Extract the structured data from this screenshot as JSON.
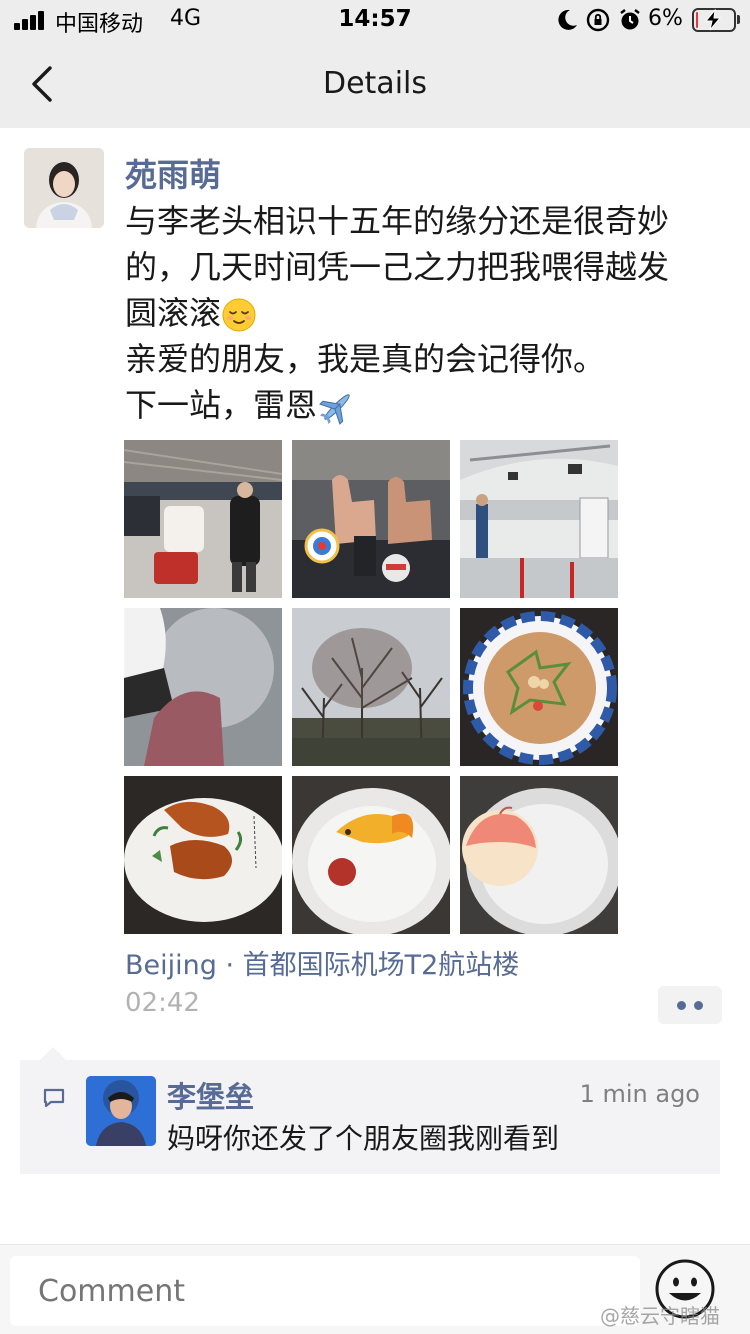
{
  "status_bar": {
    "carrier": "中国移动",
    "network": "4G",
    "time": "14:57",
    "battery": "6%",
    "battery_level": 0.06,
    "icons": [
      "signal-icon",
      "moon-icon",
      "rotation-lock-icon",
      "alarm-icon",
      "battery-icon",
      "charging-bolt-icon"
    ]
  },
  "nav": {
    "title": "Details",
    "back_icon": "chevron-left-icon"
  },
  "post": {
    "author": "苑雨萌",
    "lines": [
      "与李老头相识十五年的缘分还是很奇妙",
      "的，几天时间凭一己之力把我喂得越发",
      "圆滚滚",
      "亲爱的朋友，我是真的会记得你。",
      "下一站，雷恩"
    ],
    "line_emojis": {
      "2": "relieved-face-emoji",
      "4": "airplane-emoji"
    },
    "photos": [
      "airport-check-in-hall-photo",
      "thumbs-up-hands-photo",
      "airport-shooting-range-photo",
      "ground-and-scarf-photo",
      "winter-trees-photo",
      "soup-bowl-photo",
      "duck-dish-plate-photo",
      "goldfish-dessert-photo",
      "peach-bun-photo"
    ],
    "location": "Beijing · 首都国际机场T2航站楼",
    "time": "02:42"
  },
  "comment": {
    "author": "李堡垒",
    "time": "1 min ago",
    "text": "妈呀你还发了个朋友圈我刚看到"
  },
  "input": {
    "placeholder": "Comment"
  },
  "watermark": "@慈云守瞎猫",
  "colors": {
    "link": "#576b95",
    "bar": "#ededed",
    "comment_bg": "#f3f3f5"
  }
}
